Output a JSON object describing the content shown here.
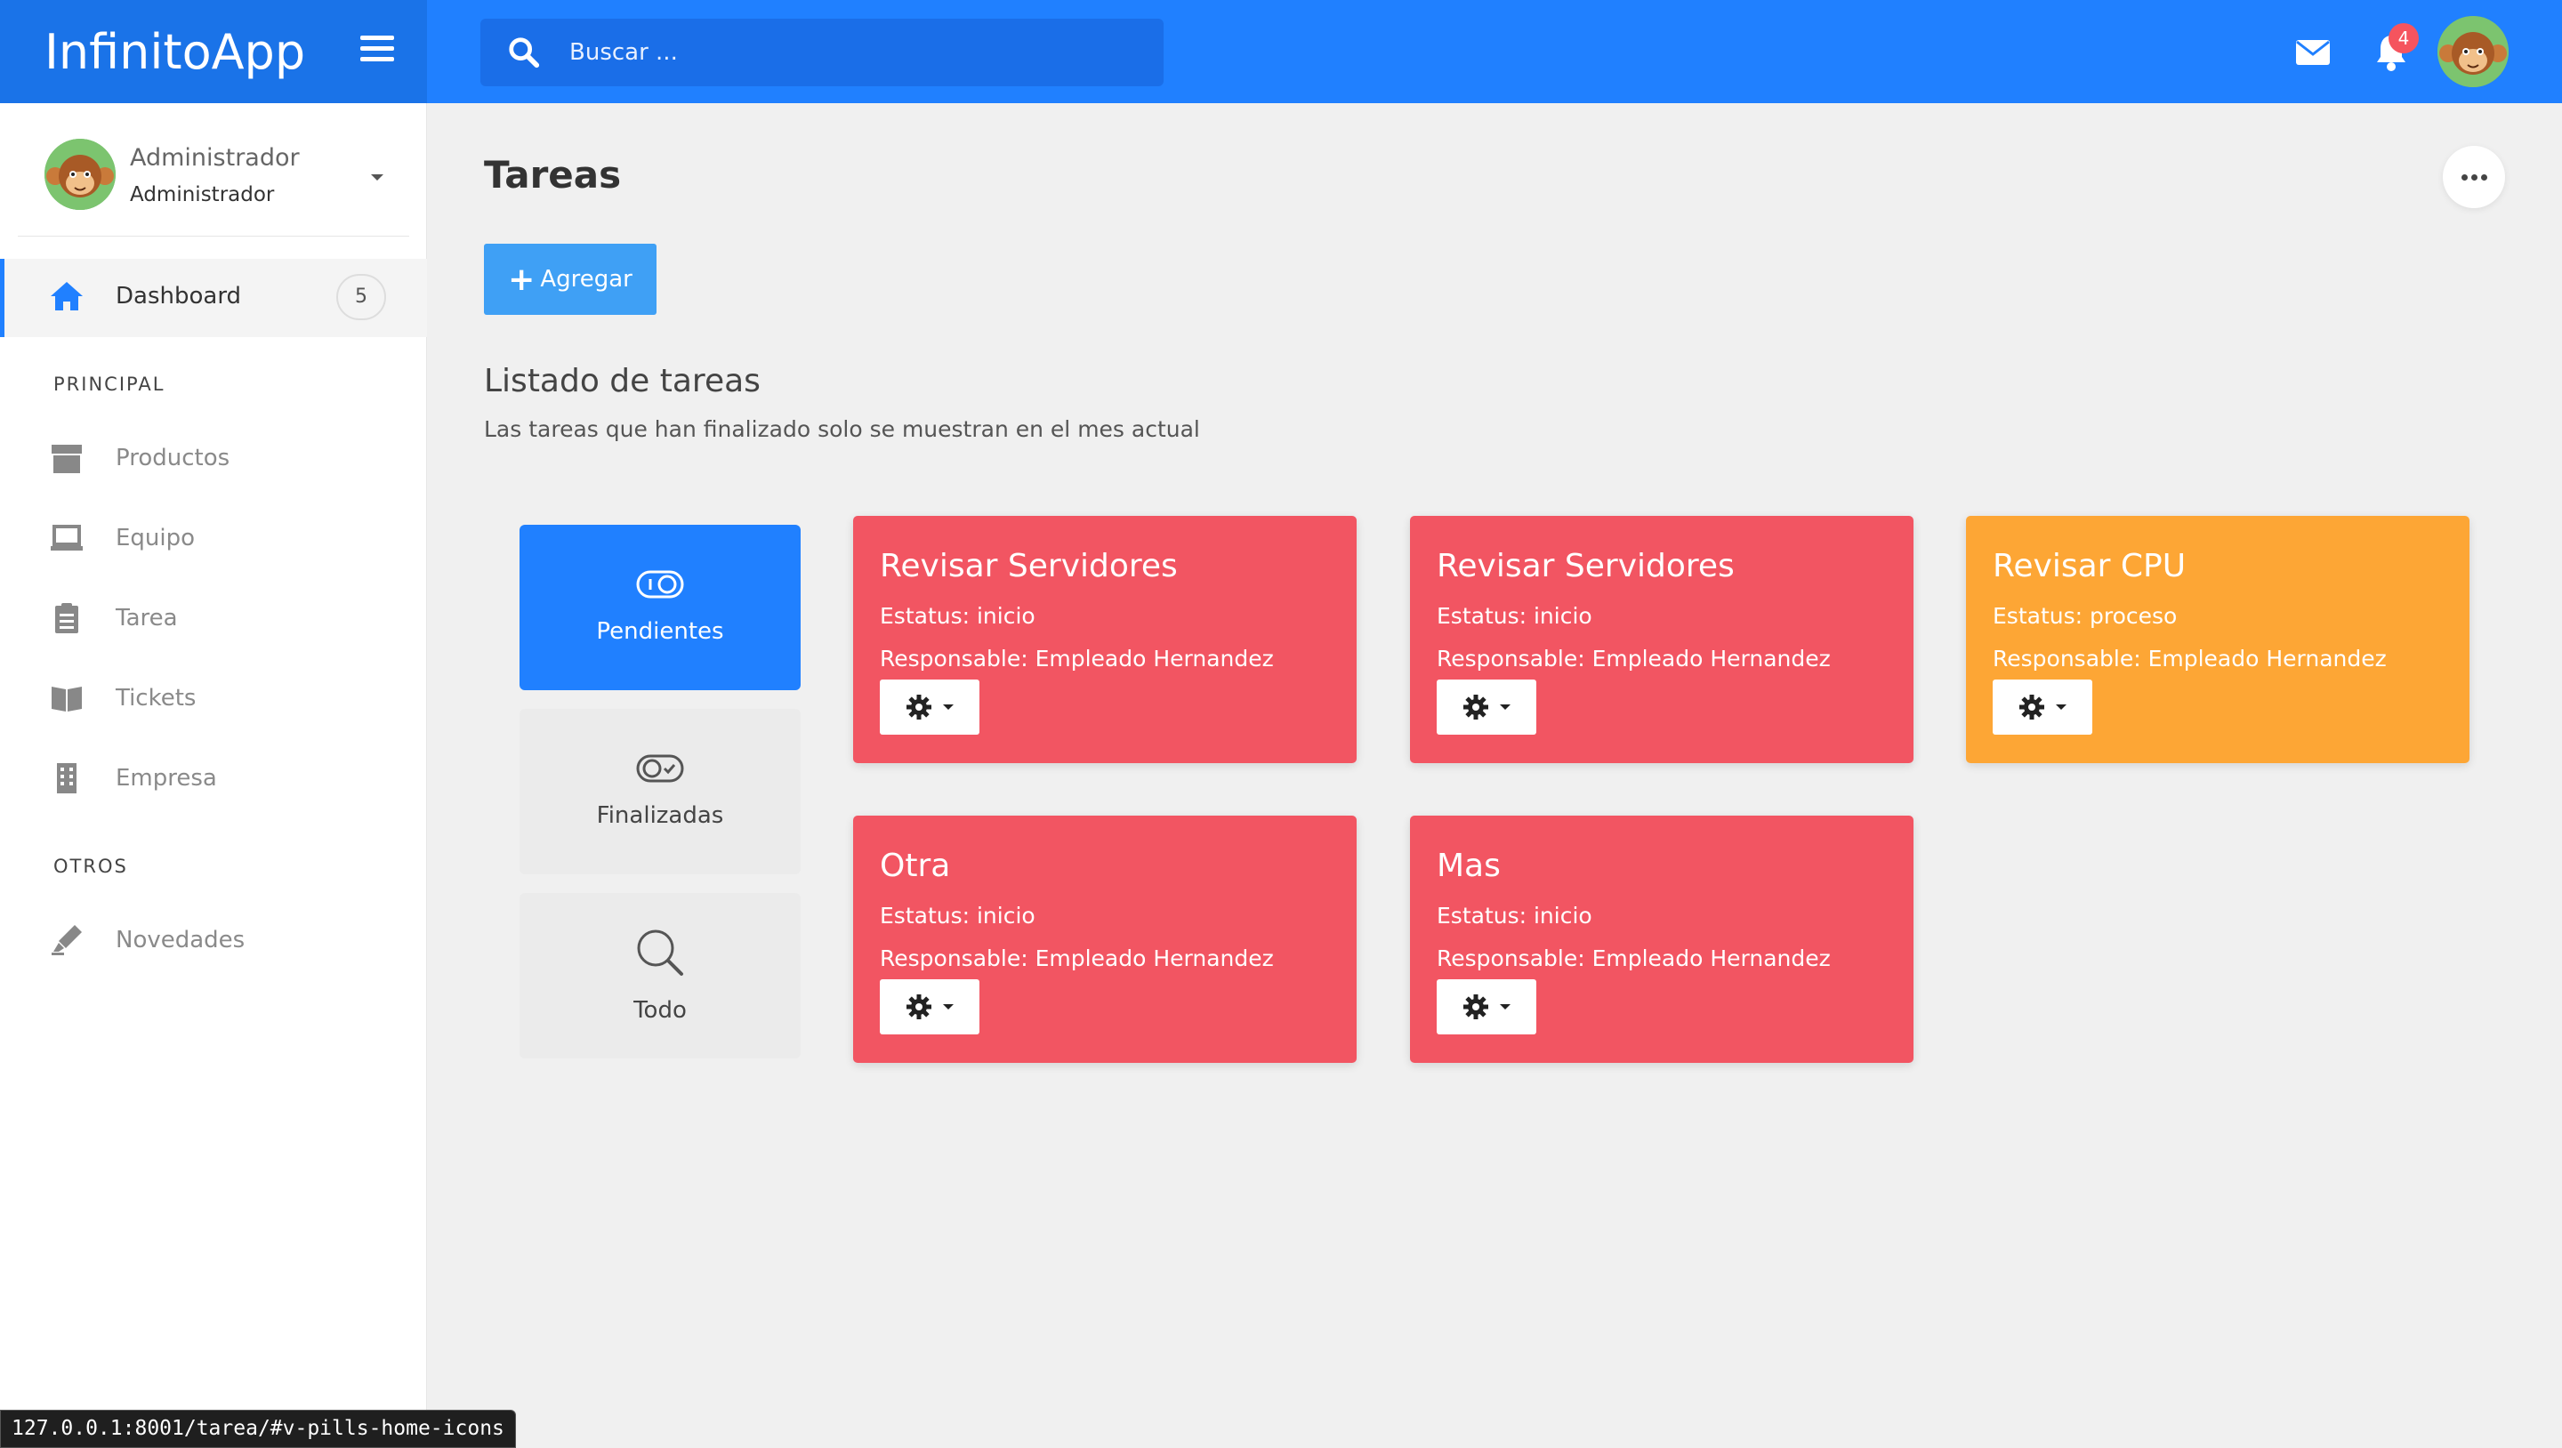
{
  "app": {
    "name": "InfinitoApp"
  },
  "search": {
    "placeholder": "Buscar ..."
  },
  "header": {
    "notification_count": "4"
  },
  "user": {
    "name": "Administrador",
    "role": "Administrador"
  },
  "sidebar": {
    "dashboard": {
      "label": "Dashboard",
      "count": "5"
    },
    "sections": [
      {
        "title": "PRINCIPAL",
        "items": [
          {
            "label": "Productos",
            "icon": "box-icon"
          },
          {
            "label": "Equipo",
            "icon": "laptop-icon"
          },
          {
            "label": "Tarea",
            "icon": "clipboard-icon"
          },
          {
            "label": "Tickets",
            "icon": "book-icon"
          },
          {
            "label": "Empresa",
            "icon": "building-icon"
          }
        ]
      },
      {
        "title": "OTROS",
        "items": [
          {
            "label": "Novedades",
            "icon": "highlighter-icon"
          }
        ]
      }
    ]
  },
  "main": {
    "title": "Tareas",
    "add_button": "Agregar",
    "list_title": "Listado de tareas",
    "list_subtitle": "Las tareas que han finalizado solo se muestran en el mes actual"
  },
  "filters": [
    {
      "label": "Pendientes",
      "icon": "toggle-off-icon",
      "active": true
    },
    {
      "label": "Finalizadas",
      "icon": "toggle-on-icon",
      "active": false
    },
    {
      "label": "Todo",
      "icon": "search-icon",
      "active": false
    }
  ],
  "tasks": [
    {
      "title": "Revisar Servidores",
      "status": "Estatus: inicio",
      "responsible": "Responsable: Empleado Hernandez",
      "color": "#f25562"
    },
    {
      "title": "Revisar Servidores",
      "status": "Estatus: inicio",
      "responsible": "Responsable: Empleado Hernandez",
      "color": "#f25562"
    },
    {
      "title": "Revisar CPU",
      "status": "Estatus: proceso",
      "responsible": "Responsable: Empleado Hernandez",
      "color": "#fda635"
    },
    {
      "title": "Otra",
      "status": "Estatus: inicio",
      "responsible": "Responsable: Empleado Hernandez",
      "color": "#f25562"
    },
    {
      "title": "Mas",
      "status": "Estatus: inicio",
      "responsible": "Responsable: Empleado Hernandez",
      "color": "#f25562"
    }
  ],
  "statusbar": {
    "url": "127.0.0.1:8001/tarea/#v-pills-home-icons"
  },
  "colors": {
    "primary": "#2080ff",
    "danger": "#f25562",
    "warning": "#fda635"
  }
}
